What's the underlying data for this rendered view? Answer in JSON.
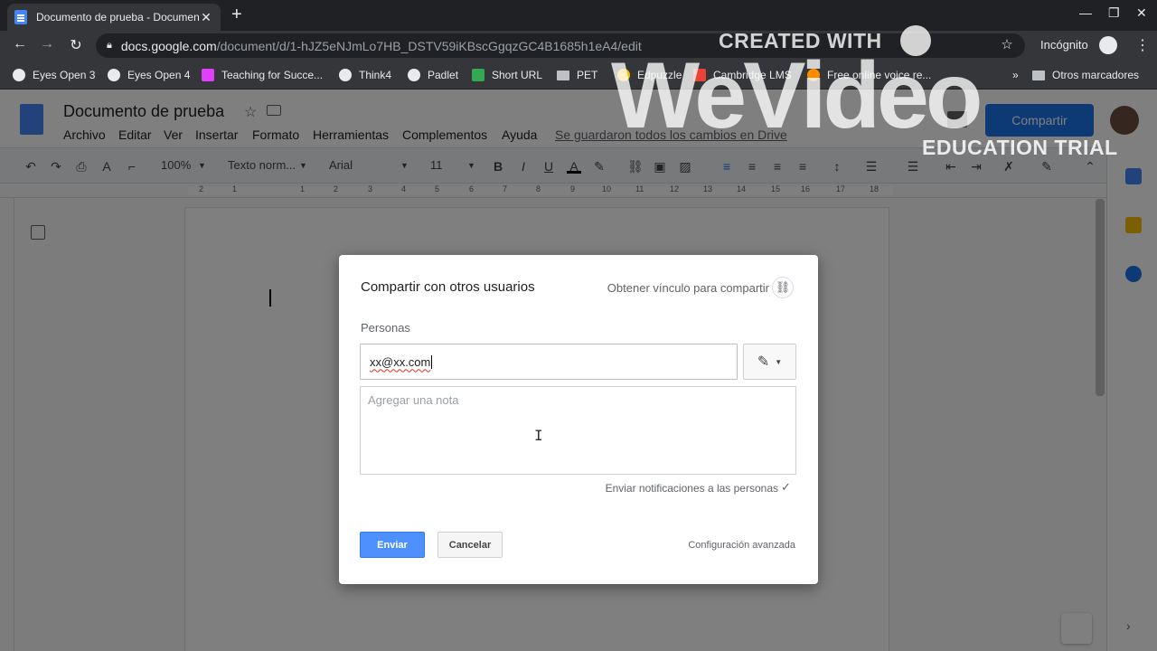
{
  "browser": {
    "tab_title": "Documento de prueba - Documen",
    "tab_close": "✕",
    "new_tab": "+",
    "url_host": "docs.google.com",
    "url_path": "/document/d/1-hJZ5eNJmLo7HB_DSTV59iKBscGgqzGC4B1685h1eA4/edit",
    "incognito_label": "Incógnito",
    "bookmarks": [
      "Eyes Open 3",
      "Eyes Open 4",
      "Teaching for Succe...",
      "Think4",
      "Padlet",
      "Short URL",
      "PET",
      "Edpuzzle",
      "Cambridge LMS",
      "Free online voice re..."
    ],
    "other_bookmarks": "Otros marcadores",
    "overflow": "»"
  },
  "docs": {
    "title": "Documento de prueba",
    "menus": [
      "Archivo",
      "Editar",
      "Ver",
      "Insertar",
      "Formato",
      "Herramientas",
      "Complementos",
      "Ayuda"
    ],
    "saved_status": "Se guardaron todos los cambios en Drive",
    "share_label": "Compartir",
    "toolbar": {
      "zoom": "100%",
      "style": "Texto norm...",
      "font": "Arial",
      "size": "11"
    },
    "ruler_numbers": [
      "2",
      "1",
      "1",
      "2",
      "3",
      "4",
      "5",
      "6",
      "7",
      "8",
      "9",
      "10",
      "11",
      "12",
      "13",
      "14",
      "15",
      "16",
      "17",
      "18"
    ]
  },
  "dialog": {
    "title": "Compartir con otros usuarios",
    "get_link": "Obtener vínculo para compartir",
    "people_label": "Personas",
    "email_value": "xx@xx.com",
    "note_placeholder": "Agregar una nota",
    "notify_label": "Enviar notificaciones a las personas",
    "notify_checked": true,
    "send_label": "Enviar",
    "cancel_label": "Cancelar",
    "advanced_label": "Configuración avanzada"
  },
  "watermark": {
    "created_with": "CREATED WITH",
    "brand": "WeVideo",
    "trial": "EDUCATION TRIAL"
  }
}
